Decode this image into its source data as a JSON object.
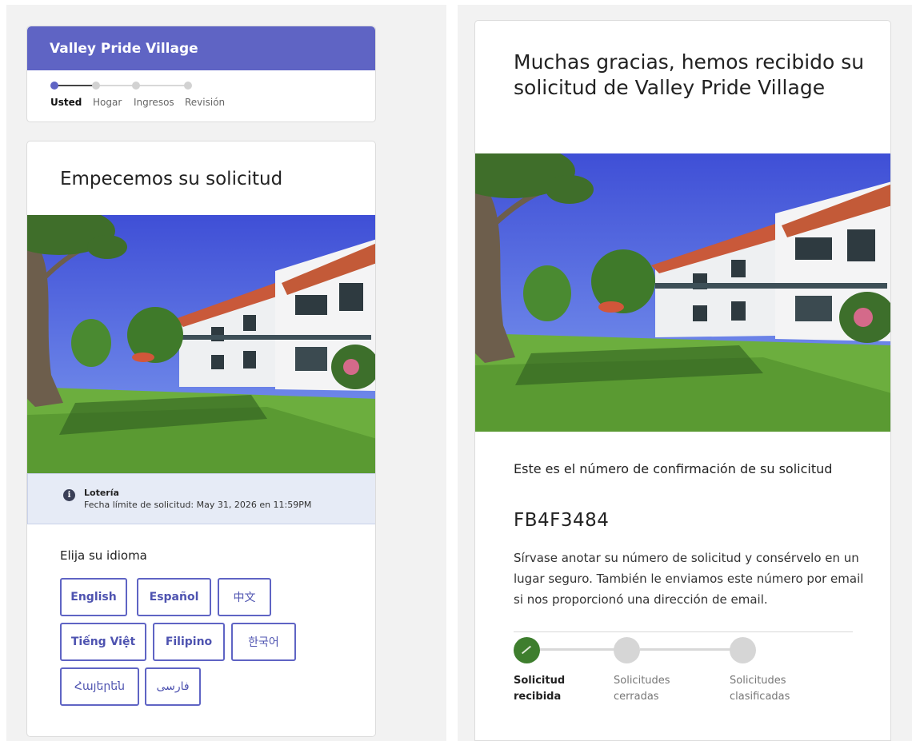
{
  "app": {
    "property_name": "Valley Pride Village"
  },
  "steps": [
    {
      "label": "Usted",
      "active": true
    },
    {
      "label": "Hogar",
      "active": false
    },
    {
      "label": "Ingresos",
      "active": false
    },
    {
      "label": "Revisión",
      "active": false
    }
  ],
  "start": {
    "title": "Empecemos su solicitud",
    "lottery_title": "Lotería",
    "deadline": "Fecha límite de solicitud: May 31, 2026 en 11:59PM",
    "language_title": "Elija su idioma",
    "languages": [
      "English",
      "Español",
      "中文",
      "Tiếng Việt",
      "Filipino",
      "한국어",
      "Հայերեն",
      "فارسی"
    ]
  },
  "confirmation": {
    "title": "Muchas gracias, hemos recibido su solicitud de Valley Pride Village",
    "number_label": "Este es el número de confirmación de su solicitud",
    "number": "FB4F3484",
    "note": "Sírvase anotar su número de solicitud y consérvelo en un lugar seguro. También le enviamos este número por email si nos proporcionó una dirección de email.",
    "status_steps": [
      {
        "label_1": "Solicitud",
        "label_2": "recibida",
        "done": true
      },
      {
        "label_1": "Solicitudes",
        "label_2": "cerradas",
        "done": false
      },
      {
        "label_1": "Solicitudes",
        "label_2": "clasificadas",
        "done": false
      }
    ]
  },
  "colors": {
    "brand": "#5f64c4",
    "info_bg": "#e6ebf6",
    "success": "#3e7e2e"
  },
  "icons": {
    "info": "info-circle-icon",
    "check": "check-icon"
  }
}
